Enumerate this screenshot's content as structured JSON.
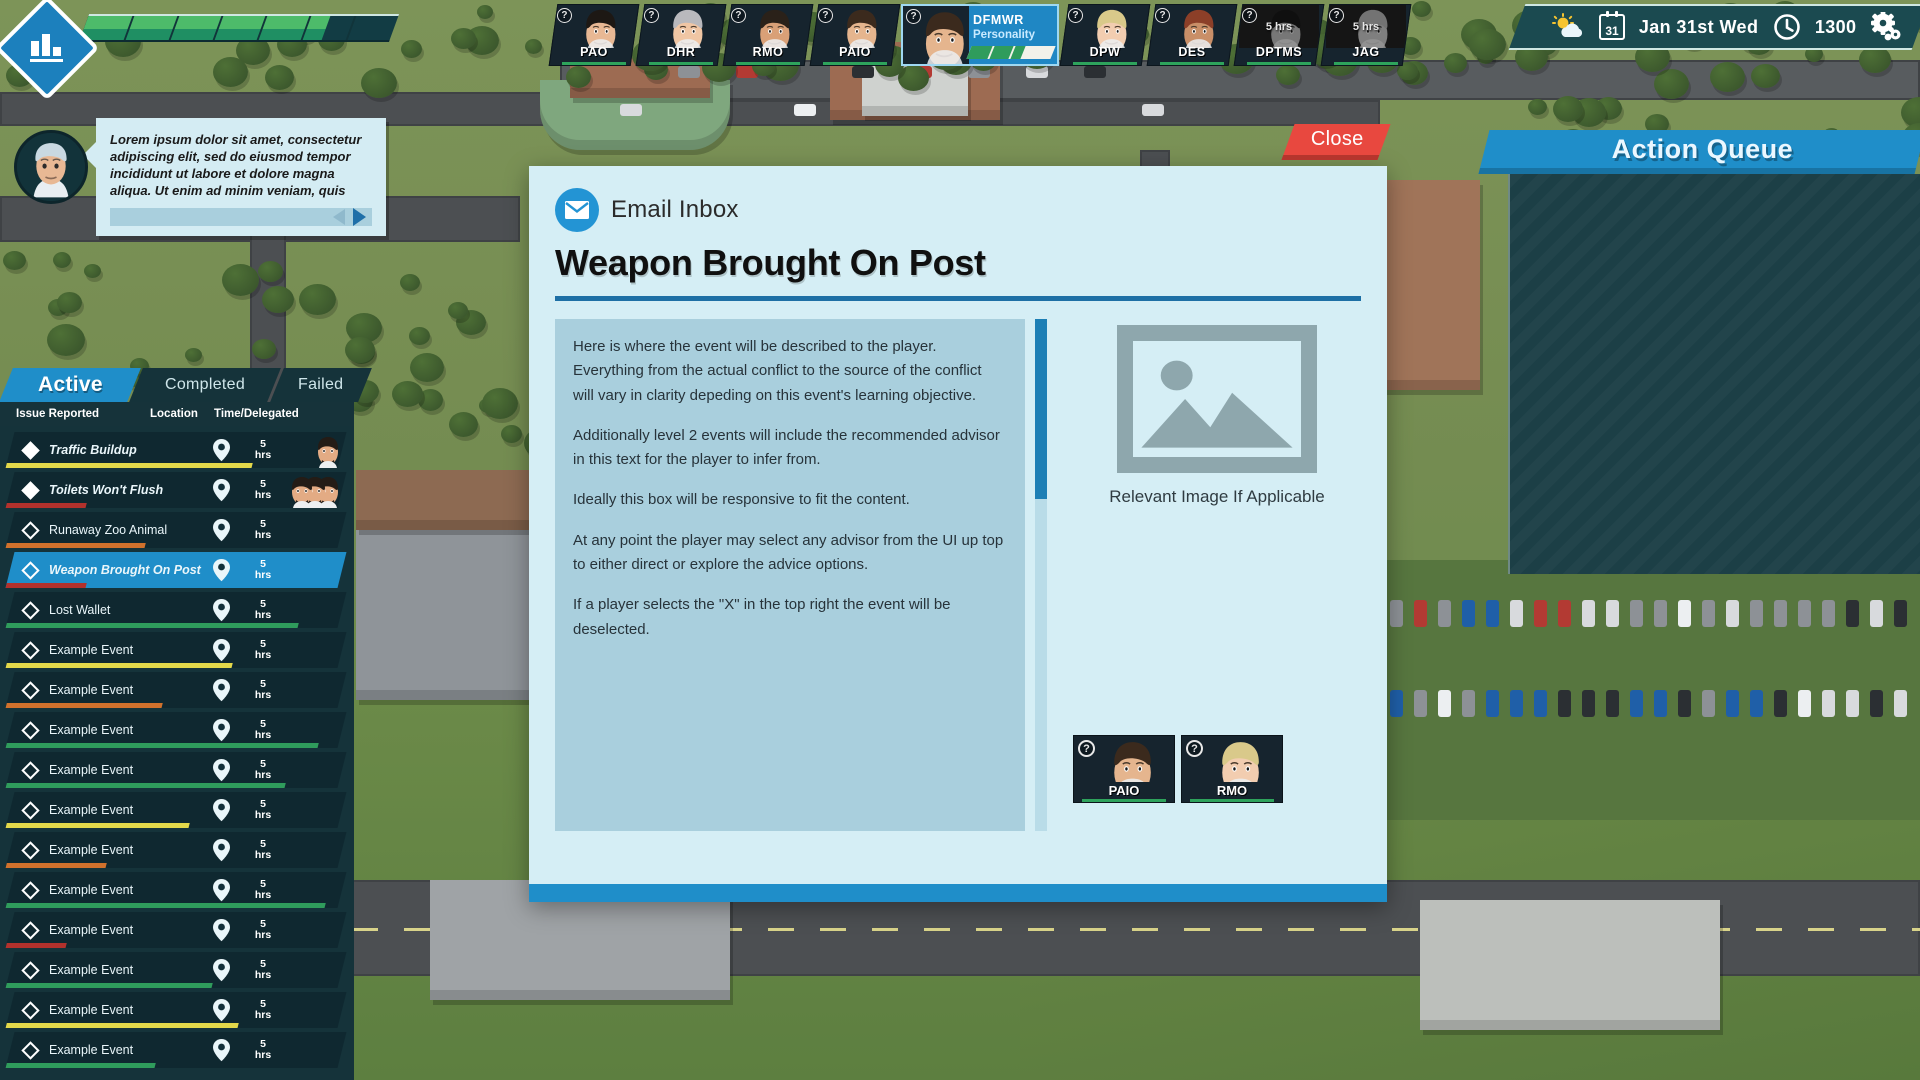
{
  "hud": {
    "logo_icon": "bar-chart-diamond-logo",
    "xp_percent": 78,
    "xp_segments": 7
  },
  "advisors": [
    {
      "id": "PAO",
      "label": "PAO",
      "badge": "?",
      "available": true,
      "hours": ""
    },
    {
      "id": "DHR",
      "label": "DHR",
      "badge": "?",
      "available": true,
      "hours": ""
    },
    {
      "id": "RMO",
      "label": "RMO",
      "badge": "?",
      "available": true,
      "hours": ""
    },
    {
      "id": "PAIO",
      "label": "PAIO",
      "badge": "?",
      "available": true,
      "hours": ""
    },
    {
      "id": "DPW",
      "label": "DPW",
      "badge": "?",
      "available": true,
      "hours": ""
    },
    {
      "id": "DES",
      "label": "DES",
      "badge": "?",
      "available": true,
      "hours": ""
    },
    {
      "id": "DPTMS",
      "label": "DPTMS",
      "badge": "?",
      "available": false,
      "hours": "5 hrs"
    },
    {
      "id": "JAG",
      "label": "JAG",
      "badge": "?",
      "available": false,
      "hours": "5 hrs"
    }
  ],
  "selected_advisor": {
    "badge": "?",
    "title": "DFMWR",
    "subtitle": "Personality",
    "meter_percent": 64,
    "meter_segments": 4
  },
  "status": {
    "weather_icon": "sun-cloud-icon",
    "calendar_icon": "calendar-icon",
    "calendar_day": "31",
    "date": "Jan 31st Wed",
    "clock_icon": "clock-icon",
    "time": "1300",
    "settings_icon": "gear-icon"
  },
  "dialogue": {
    "portrait": "advisor-portrait",
    "text": "Lorem ipsum dolor sit amet, consectetur adipiscing elit, sed do eiusmod tempor incididunt ut labore et dolore magna aliqua. Ut enim ad minim veniam, quis",
    "prev_icon": "prev-arrow-icon",
    "next_icon": "next-arrow-icon"
  },
  "issue_panel": {
    "tabs": [
      {
        "label": "Active",
        "active": true
      },
      {
        "label": "Completed",
        "active": false
      },
      {
        "label": "Failed",
        "active": false
      }
    ],
    "columns": {
      "issue": "Issue Reported",
      "location": "Location",
      "time": "Time/Delegated"
    },
    "rows": [
      {
        "label": "Traffic Buildup",
        "marker": "filled",
        "time": "5",
        "unit": "hrs",
        "progress": 74,
        "color": "#e3d84a",
        "selected": false,
        "avatars": 1
      },
      {
        "label": "Toilets Won't Flush",
        "marker": "filled",
        "time": "5",
        "unit": "hrs",
        "progress": 24,
        "color": "#b2312c",
        "selected": false,
        "avatars": 3
      },
      {
        "label": "Runaway Zoo Animal",
        "marker": "hollow",
        "time": "5",
        "unit": "hrs",
        "progress": 42,
        "color": "#d1712c",
        "selected": false,
        "avatars": 0
      },
      {
        "label": "Weapon Brought On Post",
        "marker": "hollow",
        "time": "5",
        "unit": "hrs",
        "progress": 24,
        "color": "#b2312c",
        "selected": true,
        "avatars": 0
      },
      {
        "label": "Lost Wallet",
        "marker": "hollow",
        "time": "5",
        "unit": "hrs",
        "progress": 88,
        "color": "#2f9c5c",
        "selected": false,
        "avatars": 0
      },
      {
        "label": "Example Event",
        "marker": "hollow",
        "time": "5",
        "unit": "hrs",
        "progress": 68,
        "color": "#e3d84a",
        "selected": false,
        "avatars": 0
      },
      {
        "label": "Example Event",
        "marker": "hollow",
        "time": "5",
        "unit": "hrs",
        "progress": 47,
        "color": "#d1712c",
        "selected": false,
        "avatars": 0
      },
      {
        "label": "Example Event",
        "marker": "hollow",
        "time": "5",
        "unit": "hrs",
        "progress": 94,
        "color": "#2f9c5c",
        "selected": false,
        "avatars": 0
      },
      {
        "label": "Example Event",
        "marker": "hollow",
        "time": "5",
        "unit": "hrs",
        "progress": 84,
        "color": "#2f9c5c",
        "selected": false,
        "avatars": 0
      },
      {
        "label": "Example Event",
        "marker": "hollow",
        "time": "5",
        "unit": "hrs",
        "progress": 55,
        "color": "#e3d84a",
        "selected": false,
        "avatars": 0
      },
      {
        "label": "Example Event",
        "marker": "hollow",
        "time": "5",
        "unit": "hrs",
        "progress": 30,
        "color": "#d1712c",
        "selected": false,
        "avatars": 0
      },
      {
        "label": "Example Event",
        "marker": "hollow",
        "time": "5",
        "unit": "hrs",
        "progress": 96,
        "color": "#2f9c5c",
        "selected": false,
        "avatars": 0
      },
      {
        "label": "Example Event",
        "marker": "hollow",
        "time": "5",
        "unit": "hrs",
        "progress": 18,
        "color": "#b2312c",
        "selected": false,
        "avatars": 0
      },
      {
        "label": "Example Event",
        "marker": "hollow",
        "time": "5",
        "unit": "hrs",
        "progress": 62,
        "color": "#2f9c5c",
        "selected": false,
        "avatars": 0
      },
      {
        "label": "Example Event",
        "marker": "hollow",
        "time": "5",
        "unit": "hrs",
        "progress": 70,
        "color": "#e3d84a",
        "selected": false,
        "avatars": 0
      },
      {
        "label": "Example Event",
        "marker": "hollow",
        "time": "5",
        "unit": "hrs",
        "progress": 45,
        "color": "#2f9c5c",
        "selected": false,
        "avatars": 0
      }
    ]
  },
  "action_queue": {
    "title": "Action Queue",
    "items": []
  },
  "modal": {
    "close_label": "Close",
    "mail_icon": "envelope-icon",
    "mail_label": "Email Inbox",
    "title": "Weapon Brought On Post",
    "paragraphs": [
      "Here is where the event will be described to the player. Everything from the actual conflict to the source of the conflict will vary in clarity depeding on this event's learning objective.",
      "Additionally level 2 events will include the recommended advisor in this text for the player to infer from.",
      "Ideally this box will be responsive to fit the content.",
      "At any point the player may select any advisor from the UI up top to either direct or explore the advice options.",
      "If a player selects the \"X\" in the top right the event will be deselected."
    ],
    "image_icon": "image-placeholder-icon",
    "image_caption": "Relevant Image If Applicable",
    "advisor_cards": [
      {
        "label": "PAIO",
        "badge": "?"
      },
      {
        "label": "RMO",
        "badge": "?"
      }
    ]
  },
  "colors": {
    "accent_blue": "#1f8ec9",
    "panel_dark": "#15333a",
    "close_red": "#e8483f",
    "modal_bg": "#d5eef5",
    "body_bg": "#a9cfdd"
  }
}
